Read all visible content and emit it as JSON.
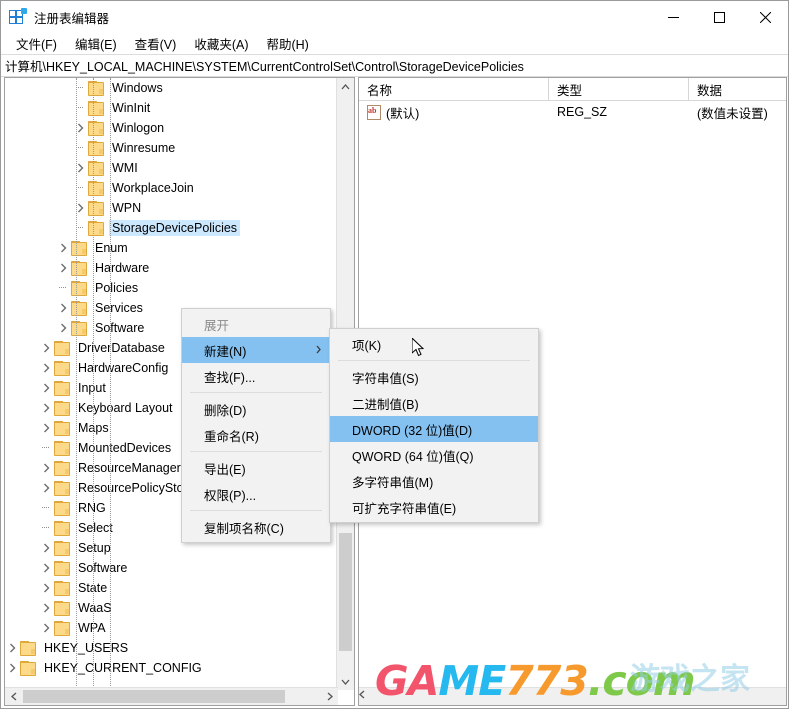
{
  "window": {
    "title": "注册表编辑器",
    "icon": "registry-editor-icon",
    "controls": {
      "minimize": "minimize-icon",
      "maximize": "maximize-icon",
      "close": "close-icon"
    }
  },
  "menubar": {
    "items": [
      {
        "label": "文件(F)"
      },
      {
        "label": "编辑(E)"
      },
      {
        "label": "查看(V)"
      },
      {
        "label": "收藏夹(A)"
      },
      {
        "label": "帮助(H)"
      }
    ]
  },
  "address": {
    "path": "计算机\\HKEY_LOCAL_MACHINE\\SYSTEM\\CurrentControlSet\\Control\\StorageDevicePolicies"
  },
  "tree": {
    "items": [
      {
        "label": "Windows",
        "indent": 5,
        "expandable": false,
        "selected": false
      },
      {
        "label": "WinInit",
        "indent": 5,
        "expandable": false,
        "selected": false
      },
      {
        "label": "Winlogon",
        "indent": 5,
        "expandable": true,
        "selected": false
      },
      {
        "label": "Winresume",
        "indent": 5,
        "expandable": false,
        "selected": false
      },
      {
        "label": "WMI",
        "indent": 5,
        "expandable": true,
        "selected": false
      },
      {
        "label": "WorkplaceJoin",
        "indent": 5,
        "expandable": false,
        "selected": false
      },
      {
        "label": "WPN",
        "indent": 5,
        "expandable": true,
        "selected": false
      },
      {
        "label": "StorageDevicePolicies",
        "indent": 5,
        "expandable": false,
        "selected": true
      },
      {
        "label": "Enum",
        "indent": 4,
        "expandable": true,
        "selected": false
      },
      {
        "label": "Hardware",
        "indent": 4,
        "expandable": true,
        "selected": false
      },
      {
        "label": "Policies",
        "indent": 4,
        "expandable": false,
        "selected": false
      },
      {
        "label": "Services",
        "indent": 4,
        "expandable": true,
        "selected": false
      },
      {
        "label": "Software",
        "indent": 4,
        "expandable": true,
        "selected": false
      },
      {
        "label": "DriverDatabase",
        "indent": 3,
        "expandable": true,
        "selected": false
      },
      {
        "label": "HardwareConfig",
        "indent": 3,
        "expandable": true,
        "selected": false
      },
      {
        "label": "Input",
        "indent": 3,
        "expandable": true,
        "selected": false
      },
      {
        "label": "Keyboard Layout",
        "indent": 3,
        "expandable": true,
        "selected": false
      },
      {
        "label": "Maps",
        "indent": 3,
        "expandable": true,
        "selected": false
      },
      {
        "label": "MountedDevices",
        "indent": 3,
        "expandable": false,
        "selected": false
      },
      {
        "label": "ResourceManager",
        "indent": 3,
        "expandable": true,
        "selected": false
      },
      {
        "label": "ResourcePolicyStore",
        "indent": 3,
        "expandable": true,
        "selected": false
      },
      {
        "label": "RNG",
        "indent": 3,
        "expandable": false,
        "selected": false
      },
      {
        "label": "Select",
        "indent": 3,
        "expandable": false,
        "selected": false
      },
      {
        "label": "Setup",
        "indent": 3,
        "expandable": true,
        "selected": false
      },
      {
        "label": "Software",
        "indent": 3,
        "expandable": true,
        "selected": false
      },
      {
        "label": "State",
        "indent": 3,
        "expandable": true,
        "selected": false
      },
      {
        "label": "WaaS",
        "indent": 3,
        "expandable": true,
        "selected": false
      },
      {
        "label": "WPA",
        "indent": 3,
        "expandable": true,
        "selected": false
      },
      {
        "label": "HKEY_USERS",
        "indent": 1,
        "expandable": true,
        "selected": false
      },
      {
        "label": "HKEY_CURRENT_CONFIG",
        "indent": 1,
        "expandable": true,
        "selected": false
      }
    ]
  },
  "list": {
    "columns": [
      {
        "label": "名称"
      },
      {
        "label": "类型"
      },
      {
        "label": "数据"
      }
    ],
    "rows": [
      {
        "name": "(默认)",
        "type": "REG_SZ",
        "data": "(数值未设置)",
        "icon": "string-value-icon"
      }
    ]
  },
  "context_menu": {
    "items": [
      {
        "label": "展开",
        "state": "disabled"
      },
      {
        "label": "新建(N)",
        "state": "highlight",
        "submenu": true
      },
      {
        "label": "查找(F)...",
        "state": "normal"
      },
      {
        "separator": true
      },
      {
        "label": "删除(D)",
        "state": "normal"
      },
      {
        "label": "重命名(R)",
        "state": "normal"
      },
      {
        "separator": true
      },
      {
        "label": "导出(E)",
        "state": "normal"
      },
      {
        "label": "权限(P)...",
        "state": "normal"
      },
      {
        "separator": true
      },
      {
        "label": "复制项名称(C)",
        "state": "normal"
      }
    ]
  },
  "submenu": {
    "items": [
      {
        "label": "项(K)",
        "state": "normal"
      },
      {
        "separator": true
      },
      {
        "label": "字符串值(S)",
        "state": "normal"
      },
      {
        "label": "二进制值(B)",
        "state": "normal"
      },
      {
        "label": "DWORD (32 位)值(D)",
        "state": "highlight"
      },
      {
        "label": "QWORD (64 位)值(Q)",
        "state": "normal"
      },
      {
        "label": "多字符串值(M)",
        "state": "normal"
      },
      {
        "label": "可扩充字符串值(E)",
        "state": "normal"
      }
    ]
  },
  "watermark": {
    "part1": "GA",
    "part2": "ME",
    "part3": "773",
    "part4": ".com",
    "overlay": "游戏之家",
    "colors": {
      "part1": "#f2556b",
      "part2": "#25b9ef",
      "part3": "#f79a2e",
      "part4": "#7ec94a"
    }
  },
  "theme": {
    "selection_blue": "#cce8ff",
    "menu_highlight": "#84c1f0",
    "folder_fill": "#fdda8a",
    "folder_border": "#e0a83a"
  }
}
